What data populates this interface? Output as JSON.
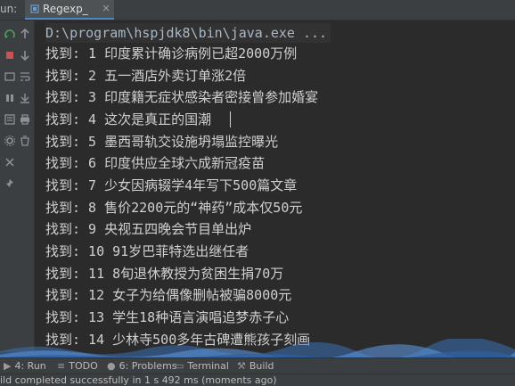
{
  "run_label": "un:",
  "tab": {
    "label": "Regexp_",
    "close": "×"
  },
  "console": {
    "command": "D:\\program\\hspjdk8\\bin\\java.exe ...",
    "lines": [
      "找到: 1 印度累计确诊病例已超2000万例",
      "找到: 2 五一酒店外卖订单涨2倍",
      "找到: 3 印度籍无症状感染者密接曾参加婚宴",
      "找到: 4 这次是真正的国潮",
      "找到: 5 墨西哥轨交设施坍塌监控曝光",
      "找到: 6 印度供应全球六成新冠疫苗",
      "找到: 7 少女因病辍学4年写下500篇文章",
      "找到: 8 售价2200元的“神药”成本仅50元",
      "找到: 9 央视五四晚会节目单出炉",
      "找到: 10 91岁巴菲特选出继任者",
      "找到: 11 8旬退休教授为贫困生捐70万",
      "找到: 12 女子为给偶像删帖被骗8000元",
      "找到: 13 学生18种语言演唱追梦赤子心",
      "找到: 14 少林寺500多年古碑遭熊孩子刻画"
    ]
  },
  "bottom_tabs": {
    "run": "4: Run",
    "todo": "TODO",
    "problems": "6: Problems",
    "terminal": "Terminal",
    "build": "Build"
  },
  "status": "ild completed successfully in 1 s 492 ms (moments ago)",
  "colors": {
    "accent": "#4a88c7",
    "background": "#2b2b2b",
    "panel": "#3c3f41"
  }
}
